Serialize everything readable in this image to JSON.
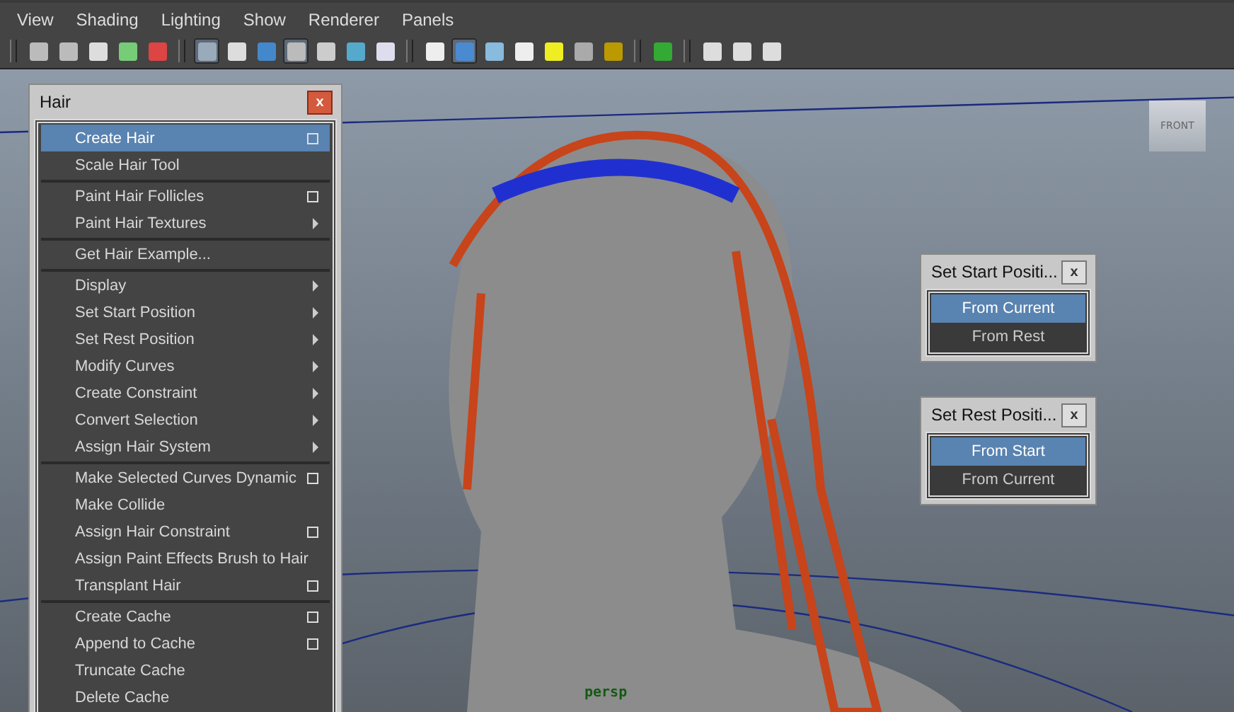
{
  "menu_bar": [
    "View",
    "Shading",
    "Lighting",
    "Show",
    "Renderer",
    "Panels"
  ],
  "toolbar": [
    {
      "selected": false
    },
    {
      "selected": false
    },
    {
      "selected": false
    },
    {
      "selected": false
    },
    {
      "selected": false
    },
    {
      "selected": true
    },
    {
      "selected": false
    },
    {
      "selected": false
    },
    {
      "selected": true
    },
    {
      "selected": false
    },
    {
      "selected": false
    },
    {
      "selected": false
    },
    {
      "selected": false
    },
    {
      "selected": true
    },
    {
      "selected": false
    },
    {
      "selected": false
    },
    {
      "selected": false
    },
    {
      "selected": false
    },
    {
      "selected": false
    },
    {
      "selected": false
    },
    {
      "selected": false
    },
    {
      "selected": false
    },
    {
      "selected": false
    }
  ],
  "view_cube": {
    "label": "FRONT"
  },
  "viewport": {
    "camera_label": "persp"
  },
  "hair_menu": {
    "title": "Hair",
    "close": "x",
    "items": [
      {
        "label": "Create Hair",
        "kind": "option",
        "selected": true,
        "separator_before": false
      },
      {
        "label": "Scale Hair Tool",
        "kind": "plain",
        "selected": false,
        "separator_before": false
      },
      {
        "label": "Paint Hair Follicles",
        "kind": "option",
        "selected": false,
        "separator_before": true
      },
      {
        "label": "Paint Hair Textures",
        "kind": "submenu",
        "selected": false,
        "separator_before": false
      },
      {
        "label": "Get Hair Example...",
        "kind": "plain",
        "selected": false,
        "separator_before": true
      },
      {
        "label": "Display",
        "kind": "submenu",
        "selected": false,
        "separator_before": true
      },
      {
        "label": "Set Start Position",
        "kind": "submenu",
        "selected": false,
        "separator_before": false
      },
      {
        "label": "Set Rest Position",
        "kind": "submenu",
        "selected": false,
        "separator_before": false
      },
      {
        "label": "Modify Curves",
        "kind": "submenu",
        "selected": false,
        "separator_before": false
      },
      {
        "label": "Create Constraint",
        "kind": "submenu",
        "selected": false,
        "separator_before": false
      },
      {
        "label": "Convert Selection",
        "kind": "submenu",
        "selected": false,
        "separator_before": false
      },
      {
        "label": "Assign Hair System",
        "kind": "submenu",
        "selected": false,
        "separator_before": false
      },
      {
        "label": "Make Selected Curves Dynamic",
        "kind": "option",
        "selected": false,
        "separator_before": true
      },
      {
        "label": "Make Collide",
        "kind": "plain",
        "selected": false,
        "separator_before": false
      },
      {
        "label": "Assign Hair Constraint",
        "kind": "option",
        "selected": false,
        "separator_before": false
      },
      {
        "label": "Assign Paint Effects Brush to Hair",
        "kind": "plain",
        "selected": false,
        "separator_before": false
      },
      {
        "label": "Transplant Hair",
        "kind": "option",
        "selected": false,
        "separator_before": false
      },
      {
        "label": "Create Cache",
        "kind": "option",
        "selected": false,
        "separator_before": true
      },
      {
        "label": "Append to Cache",
        "kind": "option",
        "selected": false,
        "separator_before": false
      },
      {
        "label": "Truncate Cache",
        "kind": "plain",
        "selected": false,
        "separator_before": false
      },
      {
        "label": "Delete Cache",
        "kind": "plain",
        "selected": false,
        "separator_before": false
      }
    ]
  },
  "popups": [
    {
      "title": "Set Start Positi...",
      "close": "x",
      "items": [
        {
          "label": "From Current",
          "selected": true
        },
        {
          "label": "From Rest",
          "selected": false
        }
      ]
    },
    {
      "title": "Set Rest Positi...",
      "close": "x",
      "items": [
        {
          "label": "From Start",
          "selected": true
        },
        {
          "label": "From Current",
          "selected": false
        }
      ]
    }
  ]
}
